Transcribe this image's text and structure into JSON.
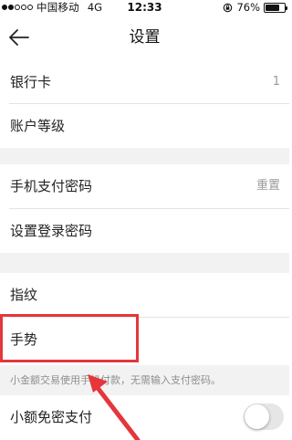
{
  "status_bar": {
    "carrier": "中国移动",
    "network": "4G",
    "time": "12:33",
    "battery_percent": "76%",
    "battery_level": 0.76,
    "signal_strength_dots": 2
  },
  "nav": {
    "title": "设置",
    "back_icon": "arrow-left-icon"
  },
  "sections": [
    {
      "rows": [
        {
          "label": "银行卡",
          "value": "1"
        },
        {
          "label": "账户等级"
        }
      ]
    },
    {
      "rows": [
        {
          "label": "手机支付密码",
          "value": "重置"
        },
        {
          "label": "设置登录密码"
        }
      ]
    },
    {
      "rows": [
        {
          "label": "指纹"
        },
        {
          "label": "手势"
        }
      ]
    }
  ],
  "hint": "小金额交易使用手机付款，无需输入支付密码。",
  "small_payment": {
    "label": "小额免密支付",
    "enabled": false
  },
  "colors": {
    "highlight": "#e5363b",
    "background_gap": "#f2f2f2"
  }
}
